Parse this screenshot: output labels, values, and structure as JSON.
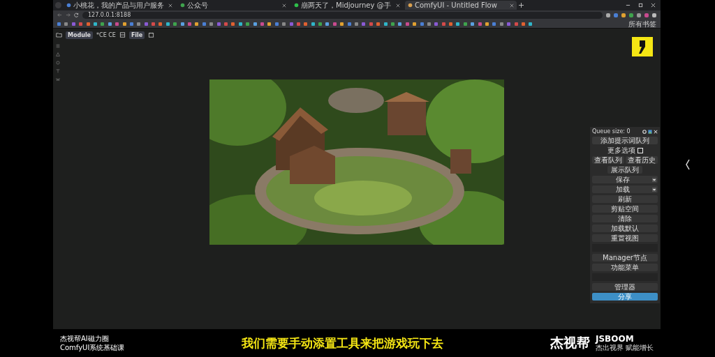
{
  "browser": {
    "tabs": [
      {
        "title": "小桃花，我的产品与用户服务",
        "selected": false
      },
      {
        "title": "公众号",
        "selected": false
      },
      {
        "title": "崩两天了，Midjourney @手",
        "selected": false
      },
      {
        "title": "ComfyUI - Untitled Flow",
        "selected": true
      }
    ],
    "address": "127.0.0.1:8188",
    "bookmarks_folder": "所有书签"
  },
  "toolbar": {
    "module": "Module",
    "shortcut": "*CE CE",
    "file_menu": "File"
  },
  "panel": {
    "queue_size": "Queue size: 0",
    "items": [
      {
        "kind": "main",
        "label": "添加提示词队列"
      },
      {
        "kind": "checkbox",
        "label": "更多选项",
        "checked": false
      },
      {
        "kind": "half",
        "labels": [
          "查看队列",
          "查看历史"
        ]
      },
      {
        "kind": "small",
        "label": "展示队列"
      },
      {
        "kind": "dropdown",
        "label": "保存"
      },
      {
        "kind": "dropdown",
        "label": "加载"
      },
      {
        "kind": "plain",
        "label": "刷新"
      },
      {
        "kind": "plain",
        "label": "剪贴空间"
      },
      {
        "kind": "plain",
        "label": "清除"
      },
      {
        "kind": "plain",
        "label": "加载默认"
      },
      {
        "kind": "plain",
        "label": "重置视图"
      },
      {
        "kind": "blank"
      },
      {
        "kind": "plain",
        "label": "Manager节点"
      },
      {
        "kind": "plain",
        "label": "功能菜单"
      },
      {
        "kind": "blank"
      },
      {
        "kind": "plain",
        "label": "管理器"
      },
      {
        "kind": "primary",
        "label": "分享"
      }
    ]
  },
  "video": {
    "course": [
      "杰视帮AI磁力圈",
      "ComfyUI系统基础课"
    ],
    "subtitle": "我们需要手动添置工具来把游戏玩下去",
    "brand": "杰视帮",
    "brand_en": "JSBOOM",
    "slogan": [
      "杰出视界",
      "赋能增长"
    ]
  }
}
